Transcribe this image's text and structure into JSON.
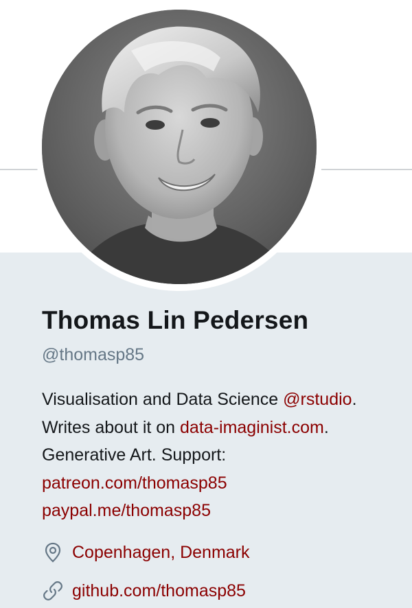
{
  "profile": {
    "name": "Thomas Lin Pedersen",
    "handle": "@thomasp85",
    "avatar_icon": "avatar-photo",
    "bio": {
      "line1_text": "Visualisation and Data Science ",
      "line1_link": "@rstudio",
      "line1_end": ".",
      "line2_text": "Writes about it on ",
      "line2_link": "data-imaginist.com",
      "line2_end": ".",
      "line3_text": "Generative Art. Support:",
      "line4_link": "patreon.com/thomasp85",
      "line5_link": "paypal.me/thomasp85"
    },
    "location": "Copenhagen, Denmark",
    "location_icon": "location-pin-icon",
    "website": "github.com/thomasp85",
    "website_icon": "link-icon"
  },
  "colors": {
    "page_background": "#e6ecf0",
    "banner_background": "#ffffff",
    "link": "#8b0000",
    "name_text": "#14171a",
    "handle_text": "#657786"
  }
}
